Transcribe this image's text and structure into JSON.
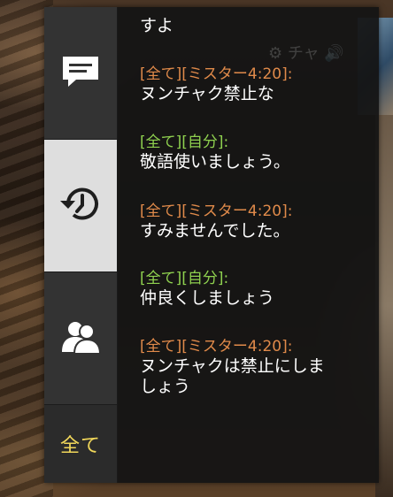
{
  "chat": {
    "tabs": [
      {
        "name": "chat-tab",
        "icon": "chat-bubble-icon"
      },
      {
        "name": "history-tab",
        "icon": "history-clock-icon"
      },
      {
        "name": "friends-tab",
        "icon": "friends-icon"
      }
    ],
    "filter_label": "全て",
    "messages": [
      {
        "header": "",
        "text": "すよ",
        "type": "other"
      },
      {
        "header": "[全て][ミスター4:20]:",
        "text": "ヌンチャク禁止な",
        "type": "other"
      },
      {
        "header": "[全て][自分]:",
        "text": "敬語使いましょう。",
        "type": "self"
      },
      {
        "header": "[全て][ミスター4:20]:",
        "text": "すみませんでした。",
        "type": "other"
      },
      {
        "header": "[全て][自分]:",
        "text": "仲良くしましょう",
        "type": "self"
      },
      {
        "header": "[全て][ミスター4:20]:",
        "text": "ヌンチャクは禁止にしま\nしょう",
        "type": "other"
      }
    ],
    "colors": {
      "other": "#e08a4a",
      "self": "#8fd14f",
      "filter": "#f1d75a",
      "active_tab": "#dedede"
    }
  }
}
